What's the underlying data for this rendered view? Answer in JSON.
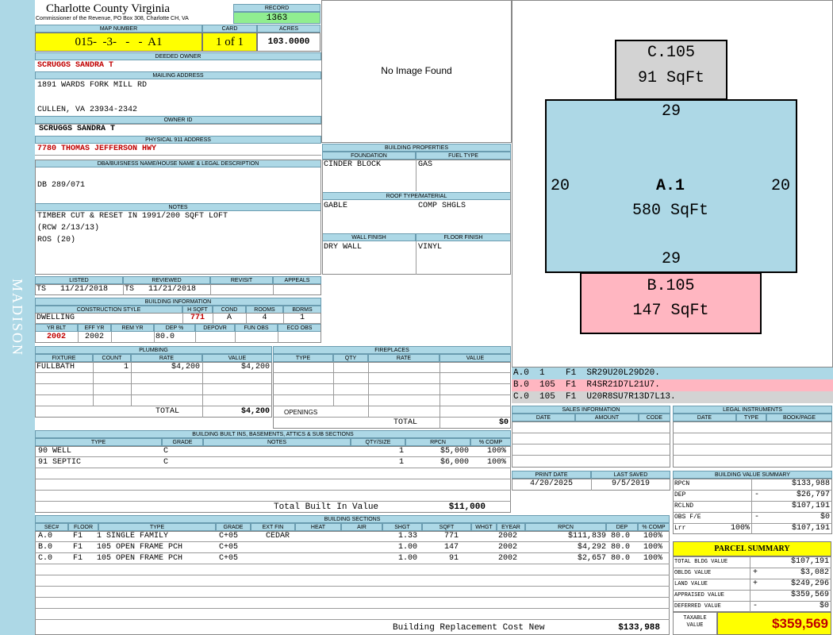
{
  "county": {
    "name": "Charlotte County Virginia",
    "subtitle": "Commissioner of the Revenue, PO Box 308, Charlotte CH, VA"
  },
  "record": {
    "label": "RECORD",
    "value": "1363"
  },
  "map_number": {
    "label": "MAP NUMBER",
    "value": "015-  -3-   -   -  A1"
  },
  "card": {
    "label": "CARD",
    "value": "1 of 1"
  },
  "acres": {
    "label": "ACRES",
    "value": "103.0000"
  },
  "deeded_owner": {
    "label": "DEEDED OWNER",
    "value": "SCRUGGS SANDRA T"
  },
  "mailing": {
    "label": "MAILING ADDRESS",
    "line1": "1891 WARDS FORK MILL RD",
    "line2": "CULLEN, VA 23934-2342"
  },
  "owner_id": {
    "label": "OWNER ID",
    "value": "SCRUGGS SANDRA T"
  },
  "physical": {
    "label": "PHYSICAL 911 ADDRESS",
    "value": "7780 THOMAS JEFFERSON HWY"
  },
  "dba": {
    "label": "DBA/BUISNESS NAME/HOUSE NAME & LEGAL DESCRIPTION",
    "value": "DB 289/071"
  },
  "notes": {
    "label": "NOTES",
    "line1": "TIMBER CUT & RESET IN 1991/200 SQFT LOFT",
    "line2": "(RCW 2/13/13)",
    "line3": "ROS (20)"
  },
  "dates": {
    "listed_label": "LISTED",
    "reviewed_label": "REVIEWED",
    "revisit_label": "REVISIT",
    "appeals_label": "APPEALS",
    "listed": "TS   11/21/2018",
    "reviewed": "TS   11/21/2018"
  },
  "building_info": {
    "label": "BUILDING INFORMATION",
    "style_label": "CONSTRUCTION STYLE",
    "hsqft_label": "H SQFT",
    "cond_label": "COND",
    "rooms_label": "ROOMS",
    "bdrms_label": "BDRMS",
    "style": "DWELLING",
    "hsqft": "771",
    "cond": "A",
    "rooms": "4",
    "bdrms": "1",
    "yrblt_label": "YR BLT",
    "effyr_label": "EFF YR",
    "remyr_label": "REM YR",
    "dep_label": "DEP %",
    "depovr_label": "DEPOVR",
    "funobs_label": "FUN OBS",
    "ecoobs_label": "ECO OBS",
    "yrblt": "2002",
    "effyr": "2002",
    "dep": "80.0"
  },
  "image": {
    "text": "No Image Found"
  },
  "building_properties": {
    "label": "BUILDING PROPERTIES",
    "foundation_label": "FOUNDATION",
    "fuel_label": "FUEL TYPE",
    "foundation": "CINDER BLOCK",
    "fuel": "GAS",
    "roof_label": "ROOF TYPE/MATERIAL",
    "roof1": "GABLE",
    "roof2": "COMP SHGLS",
    "wall_label": "WALL FINISH",
    "floor_label": "FLOOR FINISH",
    "wall": "DRY WALL",
    "floor": "VINYL"
  },
  "sketch": {
    "a": {
      "label": "A.1",
      "sqft": "580 SqFt",
      "top": "29",
      "bottom": "29",
      "left": "20",
      "right": "20"
    },
    "b": {
      "label": "B.105",
      "sqft": "147 SqFt"
    },
    "c": {
      "label": "C.105",
      "sqft": "91 SqFt"
    },
    "colors": {
      "a": "#add8e6",
      "b": "#ffb6c1",
      "c": "#d3d3d3"
    }
  },
  "sketch_legend": [
    {
      "text": "A.0  1    F1  SR29U20L29D20."
    },
    {
      "text": "B.0  105  F1  R4SR21D7L21U7."
    },
    {
      "text": "C.0  105  F1  U20R8SU7R13D7L13."
    }
  ],
  "plumbing": {
    "label": "PLUMBING",
    "fixture_label": "FIXTURE",
    "count_label": "COUNT",
    "rate_label": "RATE",
    "value_label": "VALUE",
    "fixture": "FULLBATH",
    "count": "1",
    "rate": "$4,200",
    "value": "$4,200",
    "total_label": "TOTAL",
    "total": "$4,200"
  },
  "fireplaces": {
    "label": "FIREPLACES",
    "type_label": "TYPE",
    "qty_label": "QTY",
    "rate_label": "RATE",
    "value_label": "VALUE",
    "openings_label": "OPENINGS",
    "total_label": "TOTAL",
    "total": "$0"
  },
  "sales": {
    "label": "SALES INFORMATION",
    "date_label": "DATE",
    "amount_label": "AMOUNT",
    "code_label": "CODE"
  },
  "legal": {
    "label": "LEGAL INSTRUMENTS",
    "date_label": "DATE",
    "type_label": "TYPE",
    "book_label": "BOOK/PAGE"
  },
  "print": {
    "print_label": "PRINT DATE",
    "saved_label": "LAST SAVED",
    "print_date": "4/20/2025",
    "last_saved": "9/5/2019"
  },
  "built_ins": {
    "label": "BUILDING BUILT INS, BASEMENTS, ATTICS & SUB SECTIONS",
    "type_label": "TYPE",
    "grade_label": "GRADE",
    "notes_label": "NOTES",
    "qty_label": "QTY/SIZE",
    "rpcn_label": "RPCN",
    "comp_label": "% COMP",
    "rows": [
      {
        "type": "90 WELL",
        "grade": "C",
        "qty": "1",
        "rpcn": "$5,000",
        "comp": "100%"
      },
      {
        "type": "91 SEPTIC",
        "grade": "C",
        "qty": "1",
        "rpcn": "$6,000",
        "comp": "100%"
      }
    ],
    "total_label": "Total Built In Value",
    "total": "$11,000"
  },
  "value_summary": {
    "label": "BUILDING VALUE SUMMARY",
    "rpcn_label": "RPCN",
    "rpcn": "$133,988",
    "dep_label": "DEP",
    "dep_sign": "-",
    "dep": "$26,797",
    "rclnd_label": "RCLND",
    "rclnd": "$107,191",
    "obs_label": "OBS F/E",
    "obs_sign": "-",
    "obs": "$0",
    "lrr_label": "Lrr",
    "lrr_pct": "100%",
    "lrr": "$107,191"
  },
  "building_sections": {
    "label": "BUILDING SECTIONS",
    "headers": {
      "sec": "SEC#",
      "floor": "FLOOR",
      "type": "TYPE",
      "grade": "GRADE",
      "extfin": "EXT FIN",
      "heat": "HEAT",
      "air": "AIR",
      "shgt": "SHGT",
      "sqft": "SQFT",
      "whgt": "WHGT",
      "eyear": "EYEAR",
      "rpcn": "RPCN",
      "dep": "DEP",
      "comp": "% COMP"
    },
    "rows": [
      {
        "sec": "A.0",
        "floor": "F1",
        "type": "1 SINGLE FAMILY",
        "grade": "C+05",
        "extfin": "CEDAR",
        "shgt": "1.33",
        "sqft": "771",
        "eyear": "2002",
        "rpcn": "$111,839",
        "dep": "80.0",
        "comp": "100%"
      },
      {
        "sec": "B.0",
        "floor": "F1",
        "type": "105 OPEN FRAME PCH",
        "grade": "C+05",
        "extfin": "",
        "shgt": "1.00",
        "sqft": "147",
        "eyear": "2002",
        "rpcn": "$4,292",
        "dep": "80.0",
        "comp": "100%"
      },
      {
        "sec": "C.0",
        "floor": "F1",
        "type": "105 OPEN FRAME PCH",
        "grade": "C+05",
        "extfin": "",
        "shgt": "1.00",
        "sqft": "91",
        "eyear": "2002",
        "rpcn": "$2,657",
        "dep": "80.0",
        "comp": "100%"
      }
    ],
    "total_label": "Building Replacement Cost New",
    "total": "$133,988"
  },
  "parcel_summary": {
    "label": "PARCEL SUMMARY",
    "bldg_label": "TOTAL BLDG VALUE",
    "bldg": "$107,191",
    "obldg_label": "OBLDG VALUE",
    "obldg_sign": "+",
    "obldg": "$3,082",
    "land_label": "LAND VALUE",
    "land_sign": "+",
    "land": "$249,296",
    "appraised_label": "APPRAISED VALUE",
    "appraised": "$359,569",
    "deferred_label": "DEFERRED VALUE",
    "deferred_sign": "-",
    "deferred": "$0",
    "taxable_label1": "TAXABLE",
    "taxable_label2": "VALUE",
    "taxable": "$359,569"
  },
  "side": {
    "text": "MADISON"
  },
  "colors": {
    "header_blue": "#add8e6",
    "yellow": "#ffff00",
    "record_green": "#90ee90",
    "red": "#c00000"
  }
}
